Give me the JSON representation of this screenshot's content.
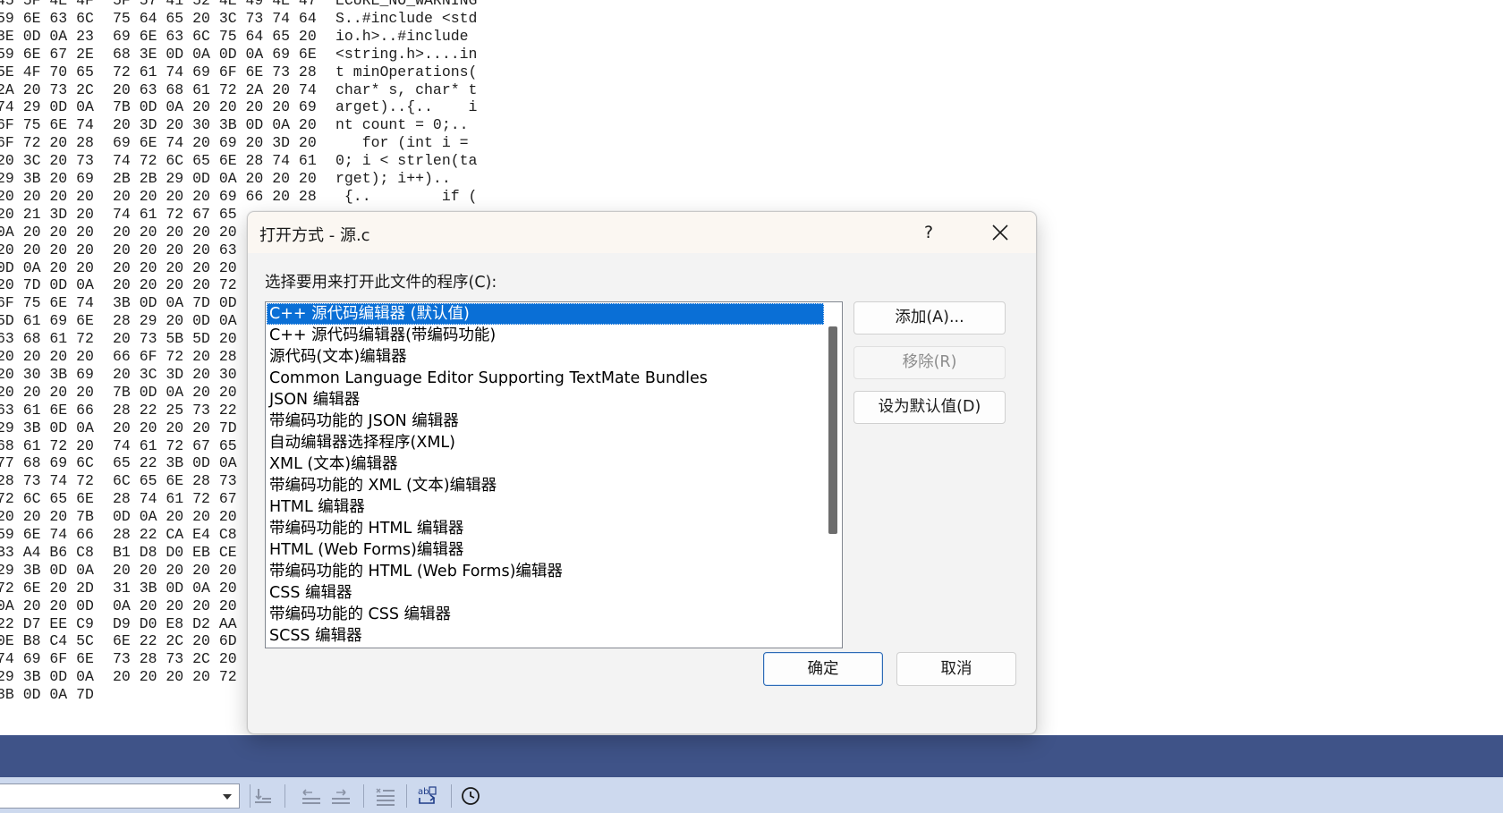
{
  "hex_editor": {
    "rows": [
      {
        "c1": "45 5F 4E 4F",
        "c2": "5F 57 41 52 4E 49 4E 47",
        "c3": "ECURE_NO_WARNING"
      },
      {
        "c1": "59 6E 63 6C",
        "c2": "75 64 65 20 3C 73 74 64",
        "c3": "S..#include <std"
      },
      {
        "c1": "3E 0D 0A 23",
        "c2": "69 6E 63 6C 75 64 65 20",
        "c3": "io.h>..#include "
      },
      {
        "c1": "59 6E 67 2E",
        "c2": "68 3E 0D 0A 0D 0A 69 6E",
        "c3": "<string.h>....in"
      },
      {
        "c1": "5E 4F 70 65",
        "c2": "72 61 74 69 6F 6E 73 28",
        "c3": "t minOperations("
      },
      {
        "c1": "2A 20 73 2C",
        "c2": "20 63 68 61 72 2A 20 74",
        "c3": "char* s, char* t"
      },
      {
        "c1": "74 29 0D 0A",
        "c2": "7B 0D 0A 20 20 20 20 69",
        "c3": "arget)..{..    i"
      },
      {
        "c1": "6F 75 6E 74",
        "c2": "20 3D 20 30 3B 0D 0A 20",
        "c3": "nt count = 0;.. "
      },
      {
        "c1": "6F 72 20 28",
        "c2": "69 6E 74 20 69 20 3D 20",
        "c3": "   for (int i = "
      },
      {
        "c1": "20 3C 20 73",
        "c2": "74 72 6C 65 6E 28 74 61",
        "c3": "0; i < strlen(ta"
      },
      {
        "c1": "29 3B 20 69",
        "c2": "2B 2B 29 0D 0A 20 20 20",
        "c3": "rget); i++).."
      },
      {
        "c1": "20 20 20 20",
        "c2": "20 20 20 20 69 66 20 28",
        "c3": " {..        if ("
      },
      {
        "c1": "20 21 3D 20",
        "c2": "74 61 72 67 65",
        "c3": ""
      },
      {
        "c1": "0A 20 20 20",
        "c2": "20 20 20 20 20",
        "c3": ""
      },
      {
        "c1": "20 20 20 20",
        "c2": "20 20 20 20 63",
        "c3": ""
      },
      {
        "c1": "0D 0A 20 20",
        "c2": "20 20 20 20 20",
        "c3": ""
      },
      {
        "c1": "20 7D 0D 0A",
        "c2": "20 20 20 20 72",
        "c3": ""
      },
      {
        "c1": "6F 75 6E 74",
        "c2": "3B 0D 0A 7D 0D",
        "c3": ""
      },
      {
        "c1": "5D 61 69 6E",
        "c2": "28 29 20 0D 0A",
        "c3": ""
      },
      {
        "c1": "63 68 61 72",
        "c2": "20 73 5B 5D 20",
        "c3": ""
      },
      {
        "c1": "20 20 20 20",
        "c2": "66 6F 72 20 28",
        "c3": ""
      },
      {
        "c1": "20 30 3B 69",
        "c2": "20 3C 3D 20 30",
        "c3": ""
      },
      {
        "c1": "20 20 20 20",
        "c2": "7B 0D 0A 20 20",
        "c3": ""
      },
      {
        "c1": "63 61 6E 66",
        "c2": "28 22 25 73 22",
        "c3": ""
      },
      {
        "c1": "29 3B 0D 0A",
        "c2": "20 20 20 20 7D",
        "c3": ""
      },
      {
        "c1": "68 61 72 20",
        "c2": "74 61 72 67 65",
        "c3": ""
      },
      {
        "c1": "77 68 69 6C",
        "c2": "65 22 3B 0D 0A",
        "c3": ""
      },
      {
        "c1": "28 73 74 72",
        "c2": "6C 65 6E 28 73",
        "c3": ""
      },
      {
        "c1": "72 6C 65 6E",
        "c2": "28 74 61 72 67",
        "c3": ""
      },
      {
        "c1": "20 20 20 7B",
        "c2": "0D 0A 20 20 20",
        "c3": ""
      },
      {
        "c1": "59 6E 74 66",
        "c2": "28 22 CA E4 C8",
        "c3": ""
      },
      {
        "c1": "B3 A4 B6 C8",
        "c2": "B1 D8 D0 EB CE",
        "c3": ""
      },
      {
        "c1": "29 3B 0D 0A",
        "c2": "20 20 20 20 20",
        "c3": ""
      },
      {
        "c1": "72 6E 20 2D",
        "c2": "31 3B 0D 0A 20",
        "c3": ""
      },
      {
        "c1": "0A 20 20 0D",
        "c2": "0A 20 20 20 20",
        "c3": ""
      },
      {
        "c1": "22 D7 EE C9",
        "c2": "D9 D0 E8 D2 AA",
        "c3": ""
      },
      {
        "c1": "0E B8 C4 5C",
        "c2": "6E 22 2C 20 6D",
        "c3": ""
      },
      {
        "c1": "74 69 6F 6E",
        "c2": "73 28 73 2C 20",
        "c3": ""
      },
      {
        "c1": "29 3B 0D 0A",
        "c2": "20 20 20 20 72",
        "c3": ""
      },
      {
        "c1": "3B 0D 0A 7D",
        "c2": "",
        "c3": ""
      }
    ]
  },
  "dialog": {
    "title": "打开方式 - 源.c",
    "help_label": "?",
    "prompt": "选择要用来打开此文件的程序(C):",
    "programs": [
      "C++ 源代码编辑器 (默认值)",
      "C++ 源代码编辑器(带编码功能)",
      "源代码(文本)编辑器",
      "Common Language Editor Supporting TextMate Bundles",
      "JSON 编辑器",
      "带编码功能的 JSON 编辑器",
      "自动编辑器选择程序(XML)",
      "XML (文本)编辑器",
      "带编码功能的 XML (文本)编辑器",
      "HTML 编辑器",
      "带编码功能的 HTML 编辑器",
      "HTML (Web Forms)编辑器",
      "带编码功能的 HTML (Web Forms)编辑器",
      "CSS 编辑器",
      "带编码功能的 CSS 编辑器",
      "SCSS 编辑器"
    ],
    "selected_index": 0,
    "add_label": "添加(A)...",
    "remove_label": "移除(R)",
    "set_default_label": "设为默认值(D)",
    "ok_label": "确定",
    "cancel_label": "取消"
  },
  "toolbar": {
    "icons": [
      "comment-icon",
      "outdent-icon",
      "indent-icon",
      "list-icon",
      "word-wrap-icon",
      "history-clock-icon"
    ]
  },
  "colors": {
    "selection": "#0a6fd6",
    "status_bar": "#3f5388",
    "toolbar": "#cdd9ee"
  }
}
